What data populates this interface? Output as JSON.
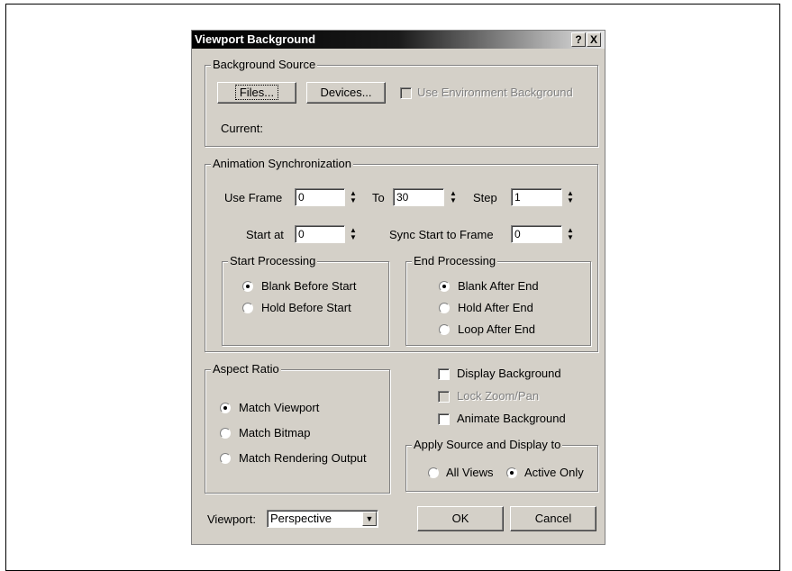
{
  "dialog": {
    "title": "Viewport Background",
    "help_icon": "?",
    "close_icon": "X"
  },
  "background_source": {
    "legend": "Background Source",
    "files_label": "Files...",
    "devices_label": "Devices...",
    "use_env_label": "Use Environment Background",
    "current_label": "Current:"
  },
  "animation_sync": {
    "legend": "Animation Synchronization",
    "use_frame_label": "Use Frame",
    "use_frame_value": "0",
    "to_label": "To",
    "to_value": "30",
    "step_label": "Step",
    "step_value": "1",
    "start_at_label": "Start at",
    "start_at_value": "0",
    "sync_start_label": "Sync Start to Frame",
    "sync_start_value": "0",
    "start_processing": {
      "legend": "Start Processing",
      "options": [
        "Blank Before Start",
        "Hold Before Start"
      ],
      "selected": 0
    },
    "end_processing": {
      "legend": "End Processing",
      "options": [
        "Blank After End",
        "Hold After End",
        "Loop After End"
      ],
      "selected": 0
    }
  },
  "aspect_ratio": {
    "legend": "Aspect Ratio",
    "options": [
      "Match Viewport",
      "Match Bitmap",
      "Match Rendering Output"
    ],
    "selected": 0
  },
  "display_options": {
    "display_background_label": "Display Background",
    "lock_zoom_label": "Lock Zoom/Pan",
    "animate_background_label": "Animate Background"
  },
  "apply_to": {
    "legend": "Apply Source and Display to",
    "options": [
      "All Views",
      "Active Only"
    ],
    "selected": 1
  },
  "footer": {
    "viewport_label": "Viewport:",
    "viewport_value": "Perspective",
    "ok_label": "OK",
    "cancel_label": "Cancel"
  }
}
